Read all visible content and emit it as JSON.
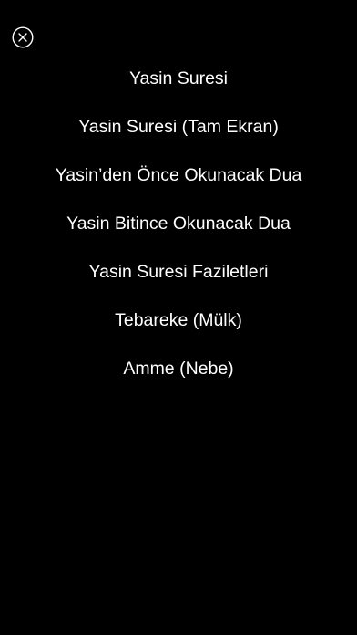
{
  "screen": {
    "background_color": "#000000",
    "text_color": "#ffffff"
  },
  "close_button": {
    "icon": "close-icon"
  },
  "menu": {
    "items": [
      {
        "label": "Yasin Suresi"
      },
      {
        "label": "Yasin Suresi (Tam Ekran)"
      },
      {
        "label": "Yasin’den Önce Okunacak Dua"
      },
      {
        "label": "Yasin Bitince Okunacak Dua"
      },
      {
        "label": "Yasin Suresi Faziletleri"
      },
      {
        "label": "Tebareke (Mülk)"
      },
      {
        "label": "Amme (Nebe)"
      }
    ]
  }
}
